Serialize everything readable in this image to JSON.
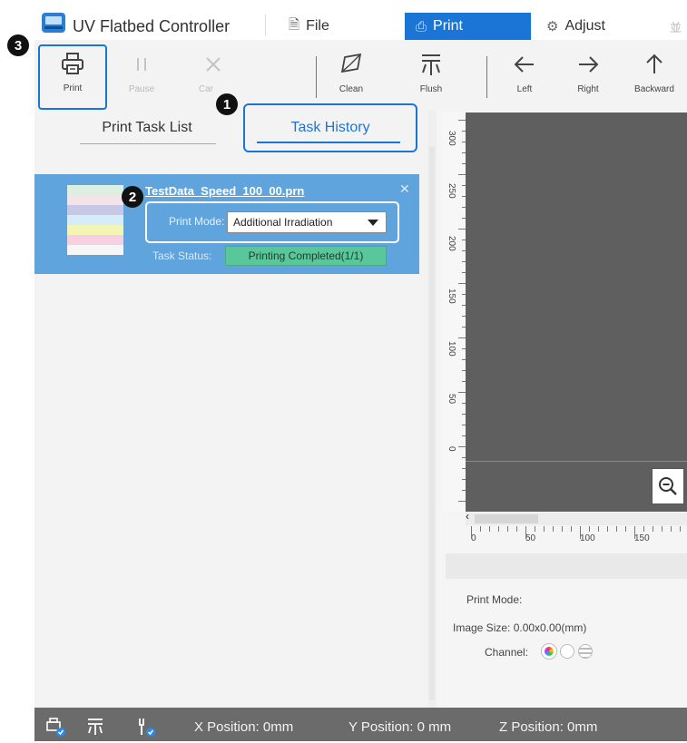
{
  "app": {
    "title": "UV Flatbed Controller"
  },
  "menu": {
    "file": "File",
    "print": "Print",
    "adjust": "Adjust",
    "more": "並"
  },
  "toolbar": [
    {
      "key": "print",
      "label": "Print",
      "icon": "printer-icon",
      "enabled": true
    },
    {
      "key": "pause",
      "label": "Pause",
      "icon": "pause-icon",
      "enabled": false
    },
    {
      "key": "cancel",
      "label": "Car",
      "icon": "cancel-icon",
      "enabled": false
    },
    {
      "key": "clean",
      "label": "Clean",
      "icon": "clean-icon",
      "enabled": true
    },
    {
      "key": "flush",
      "label": "Flush",
      "icon": "flush-icon",
      "enabled": true
    },
    {
      "key": "left",
      "label": "Left",
      "icon": "arrow-left-icon",
      "enabled": true
    },
    {
      "key": "right",
      "label": "Right",
      "icon": "arrow-right-icon",
      "enabled": true
    },
    {
      "key": "backward",
      "label": "Backward",
      "icon": "arrow-up-icon",
      "enabled": true
    }
  ],
  "tabs": {
    "list": "Print Task List",
    "history": "Task History",
    "active": "history"
  },
  "task": {
    "name": "TestData_Speed_100_00.prn",
    "mode_label": "Print Mode:",
    "mode_value": "Additional Irradiation",
    "status_label": "Task Status:",
    "status_value": "Printing Completed(1/1)",
    "thumb_colors": [
      "#dcefe1",
      "#f4e3e9",
      "#c7c7e6",
      "#d6ecf6",
      "#f4f4b5",
      "#f7cfe2",
      "#f6f6f6"
    ]
  },
  "callouts": [
    "1",
    "2",
    "3"
  ],
  "ruler": {
    "vertical": [
      "300",
      "250",
      "200",
      "150",
      "100",
      "50",
      "0"
    ],
    "horizontal": [
      "0",
      "50",
      "100",
      "150"
    ]
  },
  "info": {
    "print_mode": "Print Mode:",
    "image_size": "Image Size: 0.00x0.00(mm)",
    "channel": "Channel:"
  },
  "status": {
    "x": "X Position: 0mm",
    "y": "Y Position: 0 mm",
    "z": "Z Position: 0mm"
  },
  "colors": {
    "accent": "#1b75d6",
    "task_bg": "#5fa4dc",
    "status_ok": "#59c79a",
    "statusbar": "#6b6b6b"
  }
}
